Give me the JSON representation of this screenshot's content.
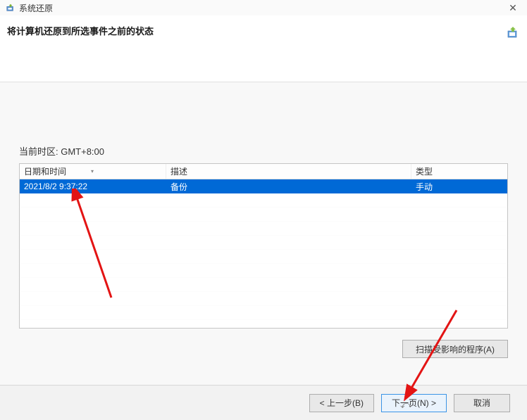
{
  "titlebar": {
    "title": "系统还原"
  },
  "header": {
    "text": "将计算机还原到所选事件之前的状态"
  },
  "timezone": {
    "label": "当前时区: GMT+8:00"
  },
  "table": {
    "headers": {
      "datetime": "日期和时间",
      "description": "描述",
      "type": "类型"
    },
    "rows": [
      {
        "datetime": "2021/8/2 9:37:22",
        "description": "备份",
        "type": "手动"
      }
    ]
  },
  "buttons": {
    "scan": "扫描受影响的程序(A)",
    "back": "< 上一步(B)",
    "next": "下一页(N) >",
    "cancel": "取消"
  }
}
